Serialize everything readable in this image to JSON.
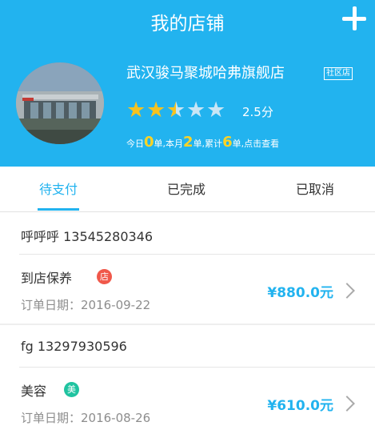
{
  "header": {
    "title": "我的店铺",
    "add_icon": "plus-icon"
  },
  "shop": {
    "name": "武汉骏马聚城哈弗旗舰店",
    "badge": "社区店",
    "rating_value": 2.5,
    "rating_text": "2.5分",
    "star_icon": "star-icon",
    "stats": {
      "today_prefix": "今日",
      "today_count": "0",
      "today_unit": "单,本月",
      "month_count": "2",
      "month_unit": "单,累计",
      "total_count": "6",
      "total_unit": "单,点击查看"
    }
  },
  "tabs": [
    {
      "label": "待支付",
      "active": true
    },
    {
      "label": "已完成",
      "active": false
    },
    {
      "label": "已取消",
      "active": false
    }
  ],
  "orders": [
    {
      "customer": "呼呼呼 13545280346",
      "service": "到店保养",
      "tag": "店",
      "tag_color": "#f0584a",
      "date": "订单日期：2016-09-22",
      "price": "¥880.0元"
    },
    {
      "customer": "fg 13297930596",
      "service": "美容",
      "tag": "美",
      "tag_color": "#1fc3a0",
      "date": "订单日期：2016-08-26",
      "price": "¥610.0元"
    }
  ],
  "colors": {
    "primary": "#22b3ef",
    "star": "#f6c21f",
    "highlight": "#ffd324"
  }
}
